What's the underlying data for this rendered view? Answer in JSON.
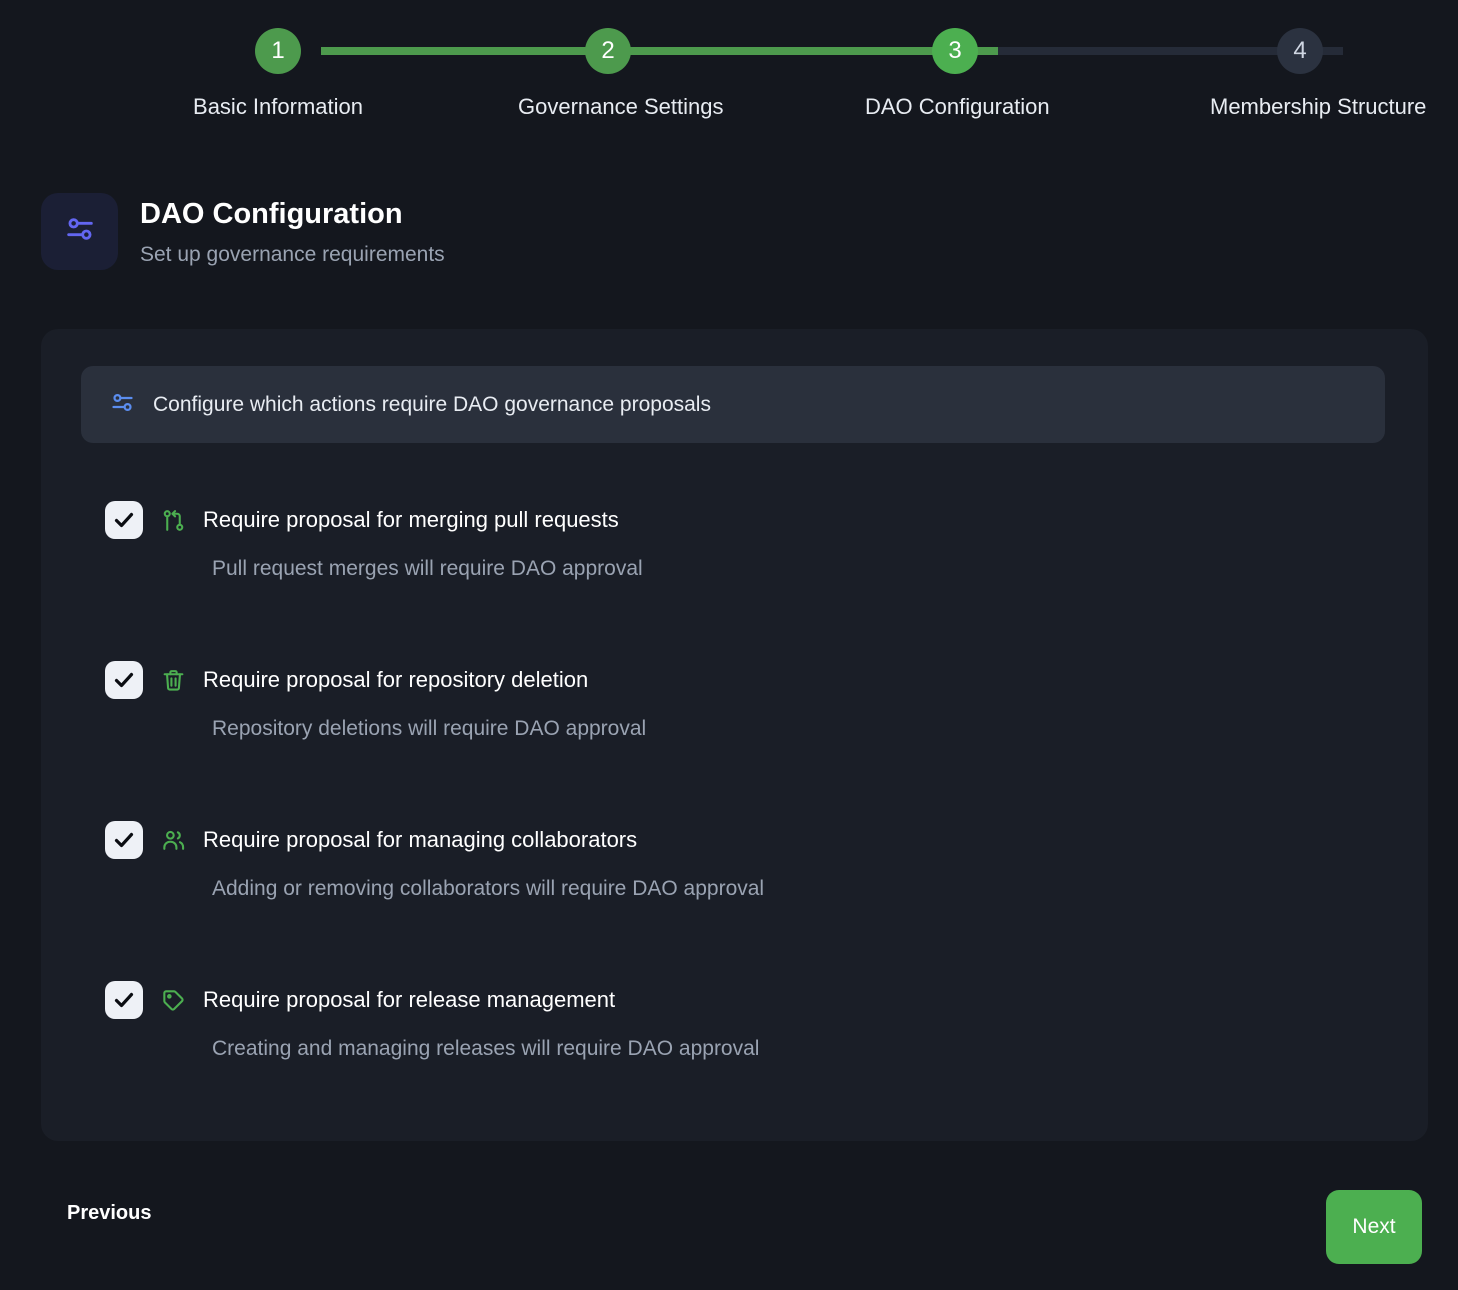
{
  "stepper": {
    "steps": [
      {
        "number": "1",
        "label": "Basic Information",
        "state": "done"
      },
      {
        "number": "2",
        "label": "Governance Settings",
        "state": "done"
      },
      {
        "number": "3",
        "label": "DAO Configuration",
        "state": "active"
      },
      {
        "number": "4",
        "label": "Membership Structure",
        "state": "todo"
      }
    ]
  },
  "header": {
    "icon": "sliders-icon",
    "title": "DAO Configuration",
    "subtitle": "Set up governance requirements"
  },
  "banner": {
    "icon": "sliders-icon",
    "text": "Configure which actions require DAO governance proposals"
  },
  "options": [
    {
      "icon": "git-pull-request-icon",
      "label": "Require proposal for merging pull requests",
      "description": "Pull request merges will require DAO approval",
      "checked": "true"
    },
    {
      "icon": "trash-icon",
      "label": "Require proposal for repository deletion",
      "description": "Repository deletions will require DAO approval",
      "checked": "true"
    },
    {
      "icon": "users-icon",
      "label": "Require proposal for managing collaborators",
      "description": "Adding or removing collaborators will require DAO approval",
      "checked": "true"
    },
    {
      "icon": "tag-icon",
      "label": "Require proposal for release management",
      "description": "Creating and managing releases will require DAO approval",
      "checked": "true"
    }
  ],
  "footer": {
    "previous_label": "Previous",
    "next_label": "Next"
  },
  "colors": {
    "page_background": "#14171e",
    "card_background": "#1a1e27",
    "banner_background": "#2a303c",
    "accent_green": "#4caf50",
    "completed_green": "#4d9a4d",
    "pending_step": "#2b3240",
    "icon_green": "#4caf50",
    "icon_indigo": "#6366f1",
    "icon_blue": "#5b8def",
    "muted_text": "#9aa3b2"
  }
}
